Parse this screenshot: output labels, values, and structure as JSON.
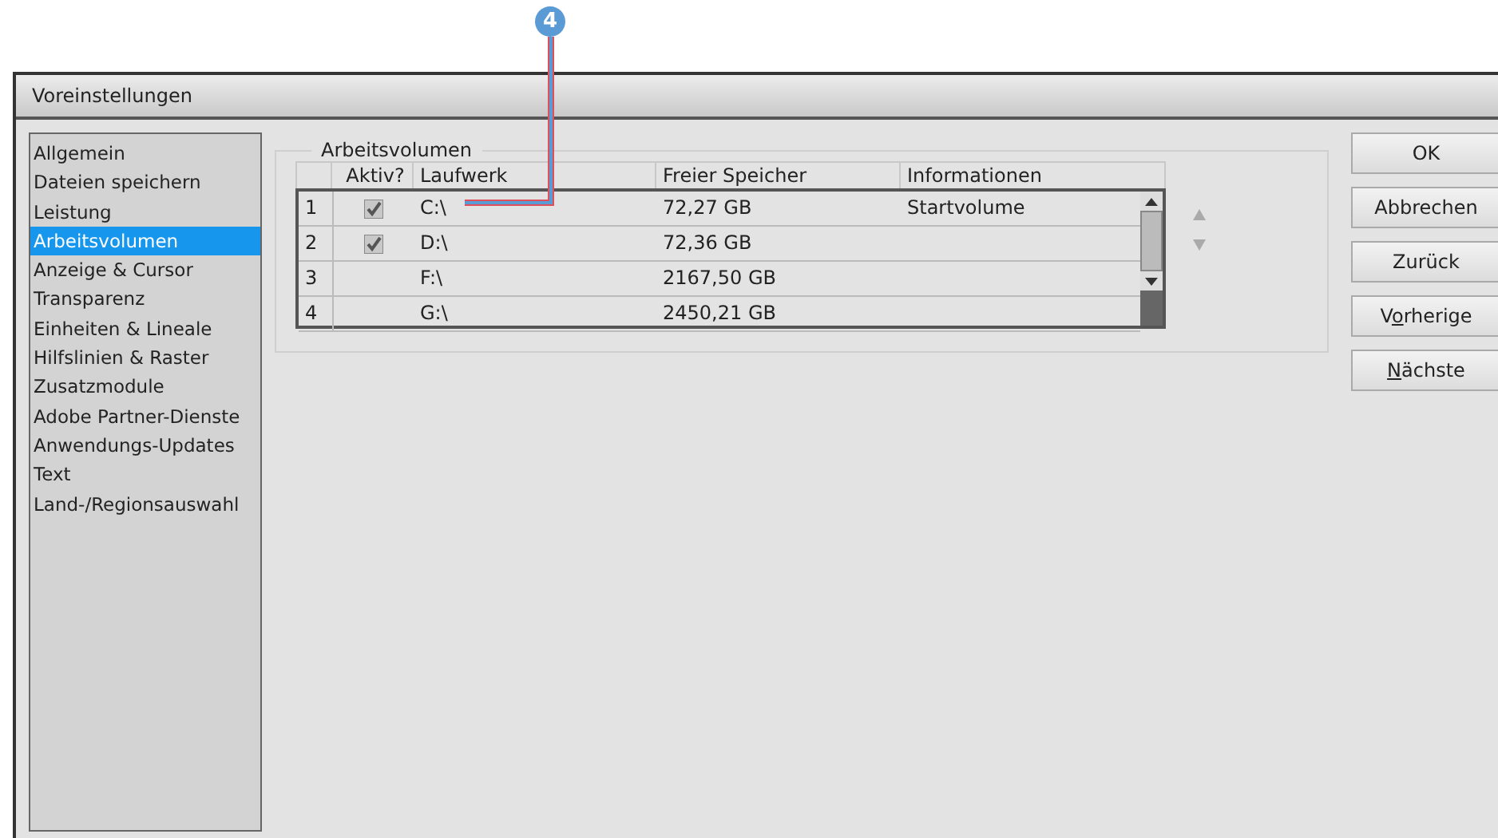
{
  "callout": {
    "label": "4"
  },
  "window": {
    "title": "Voreinstellungen"
  },
  "sidebar": {
    "items": [
      {
        "label": "Allgemein",
        "selected": false
      },
      {
        "label": "Dateien speichern",
        "selected": false
      },
      {
        "label": "Leistung",
        "selected": false
      },
      {
        "label": "Arbeitsvolumen",
        "selected": true
      },
      {
        "label": "Anzeige & Cursor",
        "selected": false
      },
      {
        "label": "Transparenz",
        "selected": false
      },
      {
        "label": "Einheiten & Lineale",
        "selected": false
      },
      {
        "label": "Hilfslinien & Raster",
        "selected": false
      },
      {
        "label": "Zusatzmodule",
        "selected": false
      },
      {
        "label": "Adobe Partner-Dienste",
        "selected": false
      },
      {
        "label": "Anwendungs-Updates",
        "selected": false
      },
      {
        "label": "Text",
        "selected": false
      },
      {
        "label": "Land-/Regionsauswahl",
        "selected": false
      }
    ]
  },
  "group": {
    "title": "Arbeitsvolumen",
    "table": {
      "columns": [
        "Aktiv?",
        "Laufwerk",
        "Freier Speicher",
        "Informationen"
      ],
      "rows": [
        {
          "number": "1",
          "checked": true,
          "drive": "C:\\",
          "free": "72,27 GB",
          "info": "Startvolume"
        },
        {
          "number": "2",
          "checked": true,
          "drive": "D:\\",
          "free": "72,36 GB"
        },
        {
          "number": "3",
          "checked": false,
          "drive": "F:\\",
          "free": "2167,50 GB"
        },
        {
          "number": "4",
          "checked": false,
          "drive": "G:\\",
          "free": "2450,21 GB"
        }
      ]
    }
  },
  "buttons": [
    {
      "label": "OK"
    },
    {
      "label": "Abbrechen"
    },
    {
      "label": "Zurück"
    },
    {
      "label_before": "V",
      "access_key": "o",
      "label_after": "rherige"
    },
    {
      "access_key": "N",
      "label_after": "ächste"
    }
  ]
}
